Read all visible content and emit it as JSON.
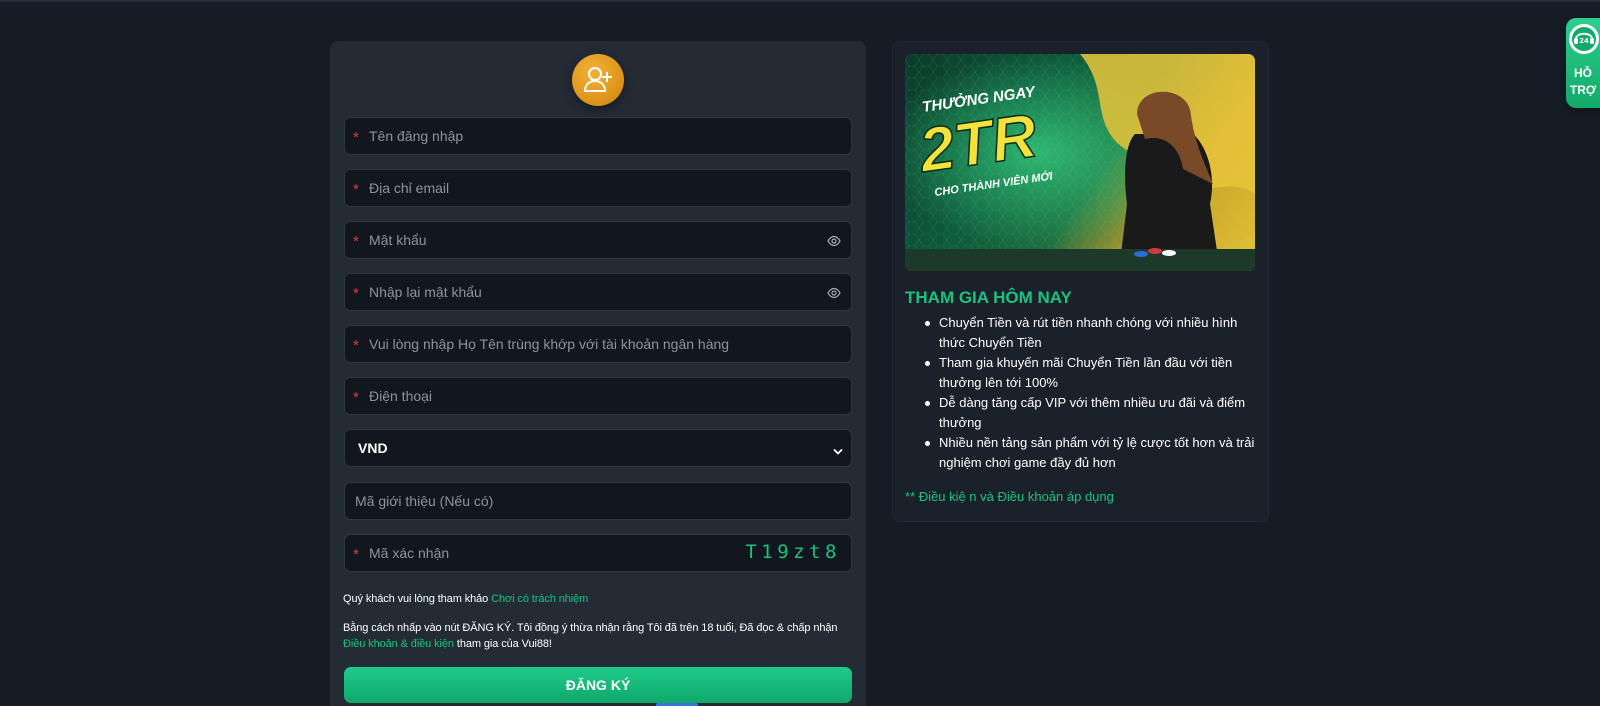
{
  "register_form": {
    "username_placeholder": "Tên đăng nhập",
    "email_placeholder": "Địa chỉ email",
    "password_placeholder": "Mật khẩu",
    "confirm_password_placeholder": "Nhập lại mật khẩu",
    "fullname_placeholder": "Vui lòng nhập Họ Tên trùng khớp với tài khoản ngân hàng",
    "phone_placeholder": "Điện thoại",
    "currency_selected": "VND",
    "referral_placeholder": "Mã giới thiệu (Nếu có)",
    "captcha_placeholder": "Mã xác nhận",
    "captcha_code": "T19zt8",
    "required_mark": "*",
    "responsible_text": "Quý khách vui lòng tham khảo",
    "responsible_link": "Chơi có trách nhiệm",
    "agreement_text": "Bằng cách nhấp vào nút ĐĂNG KÝ. Tôi đồng ý thừa nhận rằng Tôi đã trên 18 tuổi, Đã đọc & chấp nhận",
    "agreement_link": "Điều khoản & điều kiện",
    "agreement_suffix": "tham gia của Vui88!",
    "submit_label": "ĐĂNG KÝ"
  },
  "promo": {
    "banner": {
      "headline_top": "THƯỞNG NGAY",
      "headline_amount": "2TR",
      "headline_sub": "CHO THÀNH VIÊN MỚI"
    },
    "title": "THAM GIA HÔM NAY",
    "items": [
      "Chuyển Tiền và rút tiền nhanh chóng với nhiều hình thức Chuyển Tiền",
      "Tham gia khuyến mãi Chuyển Tiền lần đầu với tiền thưởng lên tới 100%",
      "Dễ dàng tăng cấp VIP với thêm nhiều ưu đãi và điểm thưởng",
      "Nhiều nền tảng sản phẩm với tỷ lệ cược tốt hơn và trải nghiệm chơi game đầy đủ hơn"
    ],
    "terms": "** Điều kiệ n và Điều khoản áp dụng"
  },
  "support": {
    "badge": "24",
    "label_line1": "HỖ",
    "label_line2": "TRỢ"
  },
  "colors": {
    "page_bg": "#161c26",
    "panel_bg": "#232b35",
    "input_bg": "#12171f",
    "accent_green": "#19c37d",
    "required_red": "#e03a3a",
    "avatar_orange": "#e0961c"
  }
}
